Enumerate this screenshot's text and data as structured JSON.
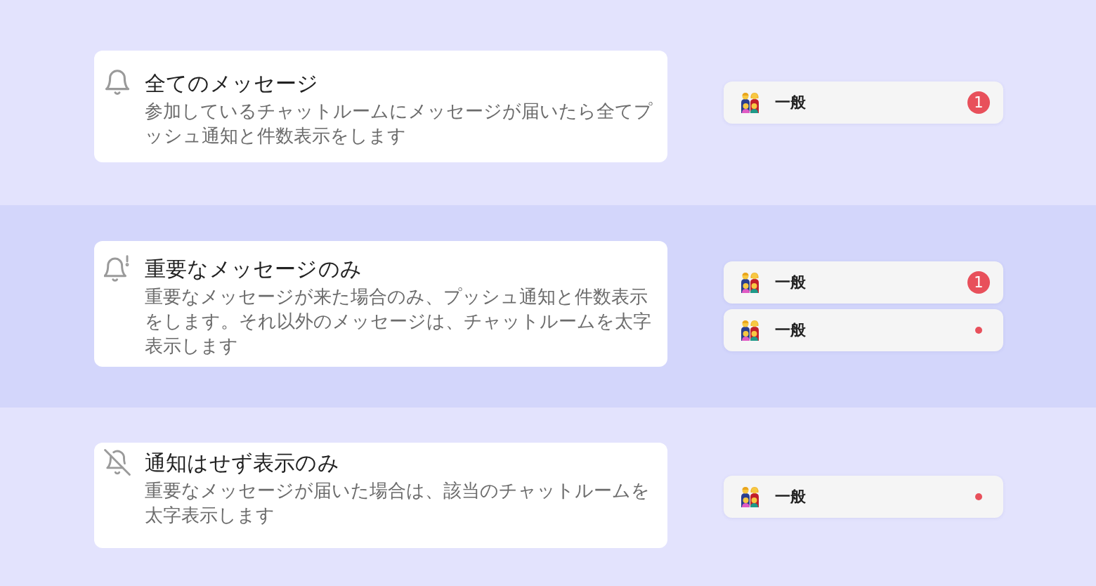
{
  "options": [
    {
      "kind": "all",
      "selected": false,
      "title": "全てのメッセージ",
      "description": "参加しているチャットルームにメッセージが届いたら全てプッシュ通知と件数表示をします",
      "rooms": [
        {
          "name": "一般",
          "indicator": {
            "kind": "count",
            "text": "1"
          }
        }
      ]
    },
    {
      "kind": "important",
      "selected": true,
      "title": "重要なメッセージのみ",
      "description": "重要なメッセージが来た場合のみ、プッシュ通知と件数表示をします。それ以外のメッセージは、チャットルームを太字表示します",
      "rooms": [
        {
          "name": "一般",
          "indicator": {
            "kind": "count",
            "text": "1"
          }
        },
        {
          "name": "一般",
          "indicator": {
            "kind": "dot"
          }
        }
      ]
    },
    {
      "kind": "silent",
      "selected": false,
      "title": "通知はせず表示のみ",
      "description": "重要なメッセージが届いた場合は、該当のチャットルームを太字表示します",
      "rooms": [
        {
          "name": "一般",
          "indicator": {
            "kind": "dot"
          }
        }
      ]
    }
  ]
}
